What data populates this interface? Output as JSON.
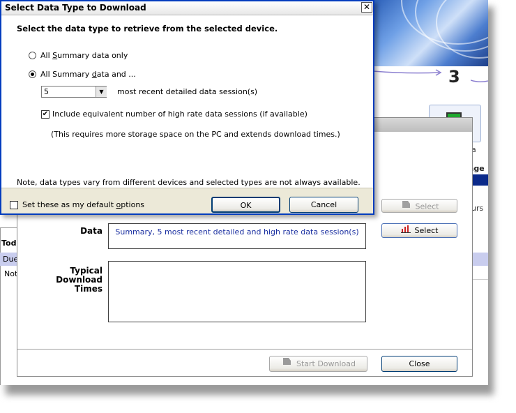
{
  "dialog": {
    "title": "Select Data Type to Download",
    "close_glyph": "✕",
    "heading": "Select the data type to retrieve from the selected device.",
    "option_summary_only": {
      "pre": "All ",
      "accel": "S",
      "post": "ummary data only",
      "checked": false
    },
    "option_summary_and": {
      "pre": "All Summary ",
      "accel": "d",
      "post": "ata and ...",
      "checked": true
    },
    "sessions_value": "5",
    "sessions_label": "most recent detailed data session(s)",
    "high_rate_label": "Include equivalent number of high rate data sessions (if available)",
    "high_rate_checked": true,
    "storage_note": "(This requires more storage space on the PC and extends download times.)",
    "note": "Note, data types vary from different devices and selected types are not always available.",
    "default_label_pre": "Set these as my default ",
    "default_label_accel": "o",
    "default_label_post": "ptions",
    "ok_label": "OK",
    "cancel_label": "Cancel"
  },
  "download_window": {
    "select_disabled_label": "Select",
    "data_label": "Data",
    "data_value": "Summary, 5 most recent detailed and high rate data session(s)",
    "data_select_label": "Select",
    "typical_label_1": "Typical",
    "typical_label_2": "Download",
    "typical_label_3": "Times",
    "start_download_label": "Start Download",
    "close_label": "Close"
  },
  "background": {
    "step_number": "3",
    "frag_a": "a",
    "frag_age": "age",
    "frag_urs": "urs",
    "frag_tod": "Tod",
    "frag_due": "Due",
    "frag_not": "Not"
  },
  "colors": {
    "dialog_border": "#003cbe",
    "dialog_face": "#ece9d8",
    "header_strip": "#c9cdee",
    "banner_blue": "#2b5fb8"
  }
}
